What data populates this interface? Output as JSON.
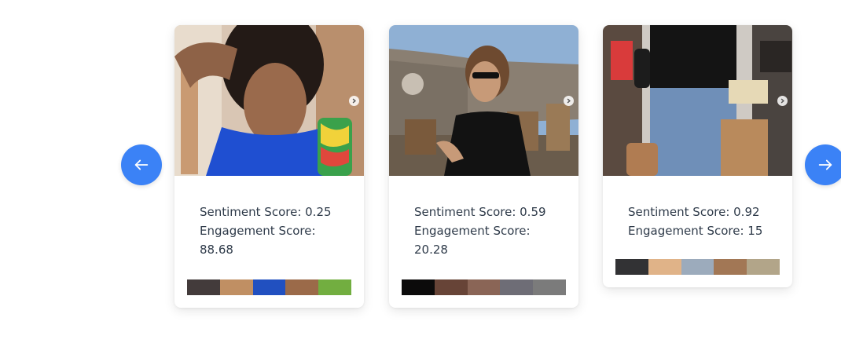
{
  "carousel": {
    "prev_icon": "arrow-left-icon",
    "next_icon": "arrow-right-icon",
    "accent": "#3b82f6"
  },
  "cards": [
    {
      "sentiment_label": "Sentiment Score: 0.25",
      "engagement_label": "Engagement Score:",
      "engagement_value": "88.68",
      "palette": [
        "#433b3b",
        "#c08f63",
        "#2150c0",
        "#9b6a49",
        "#72ae40"
      ]
    },
    {
      "sentiment_label": "Sentiment Score: 0.59",
      "engagement_label": "Engagement Score:",
      "engagement_value": "20.28",
      "palette": [
        "#0c0b0b",
        "#674437",
        "#8a6556",
        "#6e6d76",
        "#7b7b7b"
      ]
    },
    {
      "sentiment_label": "Sentiment Score: 0.92",
      "engagement_label": "Engagement Score: 15",
      "palette": [
        "#323234",
        "#e0b388",
        "#9cabbc",
        "#a27755",
        "#b2a589"
      ]
    }
  ]
}
